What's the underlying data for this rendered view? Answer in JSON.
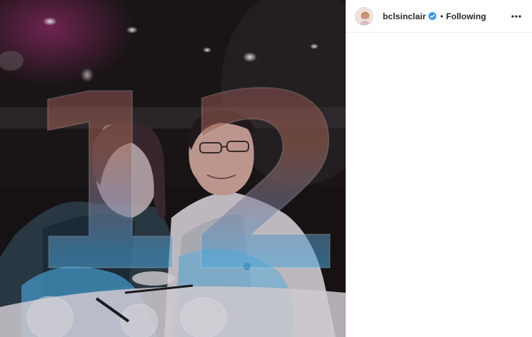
{
  "post": {
    "overlay_text": "12",
    "colors": {
      "magenta": "#7d2d5a",
      "orange": "#c07a5a",
      "cyan": "#57b3e8",
      "dark": "#1b1618"
    }
  },
  "header": {
    "username": "bclsinclair",
    "separator": "•",
    "follow_status": "Following",
    "avatar_icon": "profile-avatar",
    "verified_icon": "verified-badge-icon",
    "more_icon": "more-options-icon",
    "accent_color": "#3897f0"
  }
}
